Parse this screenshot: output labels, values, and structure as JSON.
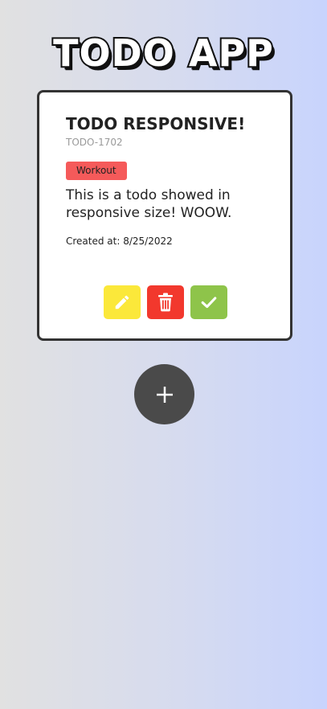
{
  "app": {
    "title": "TODO APP"
  },
  "todo": {
    "title": "TODO RESPONSIVE!",
    "id": "TODO-1702",
    "tag": "Workout",
    "description": "This is a todo showed in responsive size! WOOW.",
    "created": "Created at: 8/25/2022"
  },
  "actions": {
    "edit_icon": "pencil-icon",
    "delete_icon": "trash-icon",
    "complete_icon": "check-icon",
    "add_icon": "plus-icon"
  },
  "colors": {
    "edit": "#fbe83a",
    "delete": "#f2382d",
    "complete": "#8ec44a",
    "tag": "#f55a5a",
    "add_button": "#4a4a4a"
  }
}
